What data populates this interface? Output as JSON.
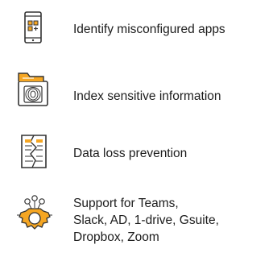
{
  "features": [
    {
      "icon": "phone-apps-icon",
      "label": "Identify misconfigured apps"
    },
    {
      "icon": "folder-fingerprint-icon",
      "label": "Index sensitive information"
    },
    {
      "icon": "torn-document-icon",
      "label": "Data loss prevention"
    },
    {
      "icon": "integration-gear-icon",
      "label_lines": [
        "Support for Teams,",
        "Slack, AD, 1-drive, Gsuite,",
        "Dropbox, Zoom"
      ]
    }
  ],
  "colors": {
    "accent": "#f5a623",
    "outline": "#333333"
  }
}
